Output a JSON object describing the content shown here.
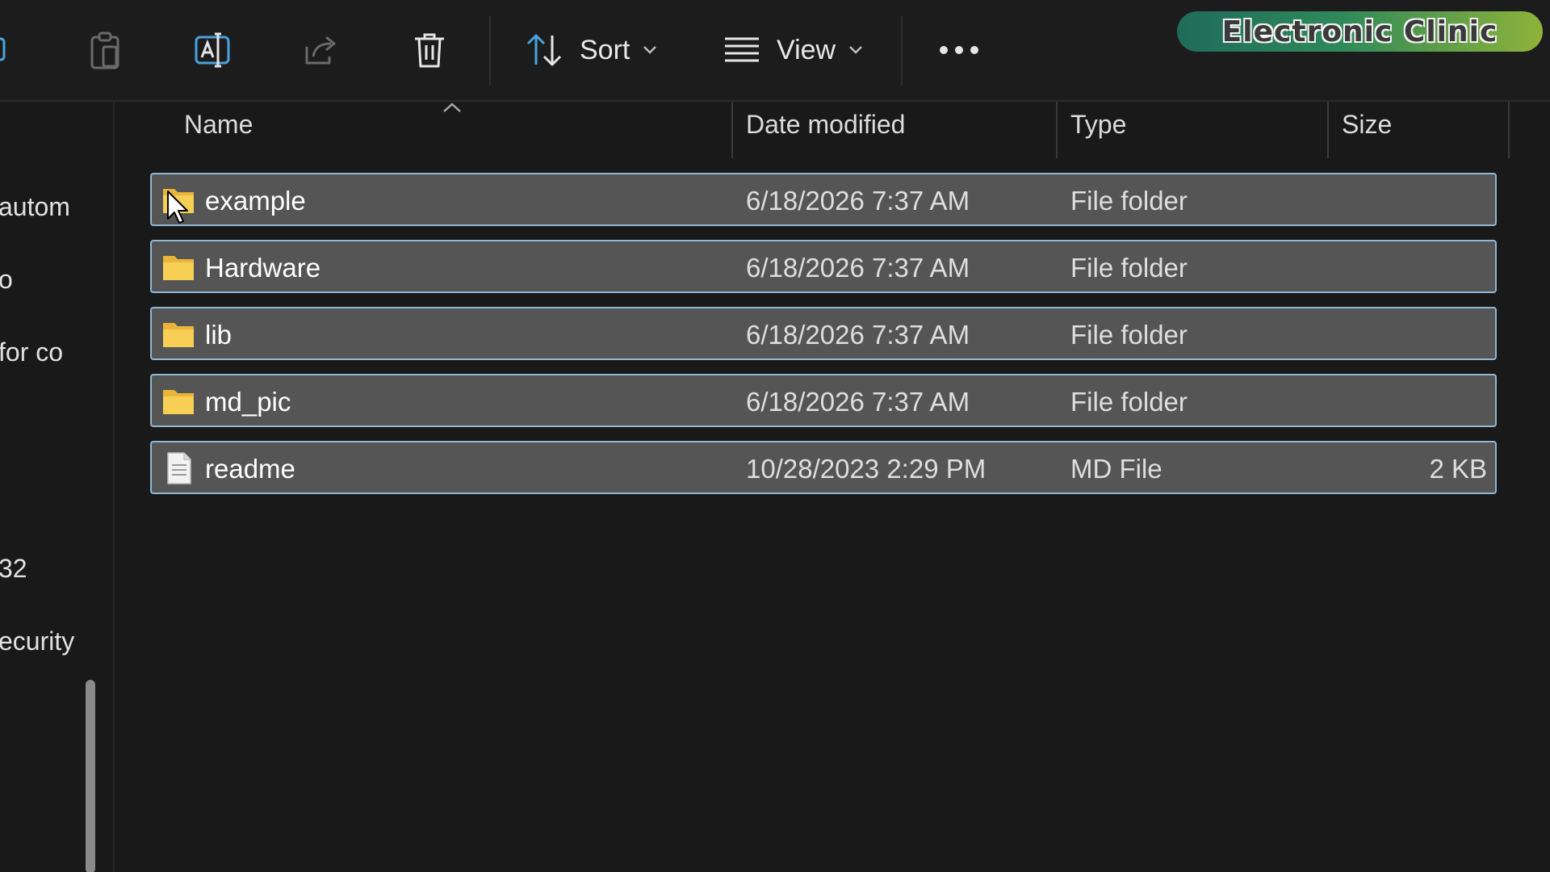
{
  "toolbar": {
    "sort_label": "Sort",
    "view_label": "View"
  },
  "brand": {
    "text": "Electronic Clinic"
  },
  "sidebar": {
    "items": [
      "autom",
      "o",
      "for co",
      "32",
      "ecurity"
    ]
  },
  "columns": {
    "name": "Name",
    "date_modified": "Date modified",
    "type": "Type",
    "size": "Size"
  },
  "files": [
    {
      "name": "example",
      "date": "6/18/2026 7:37 AM",
      "type": "File folder",
      "size": "",
      "icon": "folder-icon"
    },
    {
      "name": "Hardware",
      "date": "6/18/2026 7:37 AM",
      "type": "File folder",
      "size": "",
      "icon": "folder-icon"
    },
    {
      "name": "lib",
      "date": "6/18/2026 7:37 AM",
      "type": "File folder",
      "size": "",
      "icon": "folder-icon"
    },
    {
      "name": "md_pic",
      "date": "6/18/2026 7:37 AM",
      "type": "File folder",
      "size": "",
      "icon": "folder-icon"
    },
    {
      "name": "readme",
      "date": "10/28/2023 2:29 PM",
      "type": "MD File",
      "size": "2 KB",
      "icon": "document-icon"
    }
  ],
  "colors": {
    "background": "#191919",
    "row_selected": "#555555",
    "row_border": "#8fb7d6",
    "folder": "#f5c542",
    "accent": "#4aa3df"
  }
}
